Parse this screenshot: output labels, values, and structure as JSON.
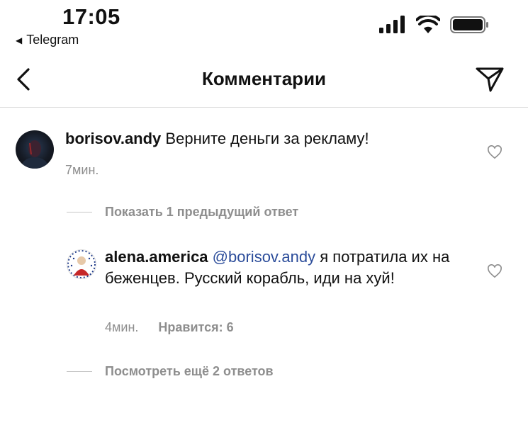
{
  "status_bar": {
    "time": "17:05",
    "back_app": "Telegram",
    "icons": [
      "signal-icon",
      "wifi-icon",
      "battery-icon"
    ]
  },
  "header": {
    "title": "Комментарии",
    "back_icon": "chevron-left-icon",
    "send_icon": "paper-plane-icon"
  },
  "comments": [
    {
      "username": "borisov.andy",
      "text": "Верните деньги за рекламу!",
      "time": "7мин.",
      "replies_toggle": "Показать 1 предыдущий ответ"
    },
    {
      "username": "alena.america",
      "mention": "@borisov.andy",
      "text": "я потратила их на беженцев. Русский корабль, иди на хуй!",
      "time": "4мин.",
      "likes": "Нравится: 6",
      "replies_toggle": "Посмотреть ещё 2 ответов"
    }
  ],
  "colors": {
    "mention": "#2b4c9a",
    "muted": "#8e8e8e",
    "divider": "#dbdbdb"
  }
}
